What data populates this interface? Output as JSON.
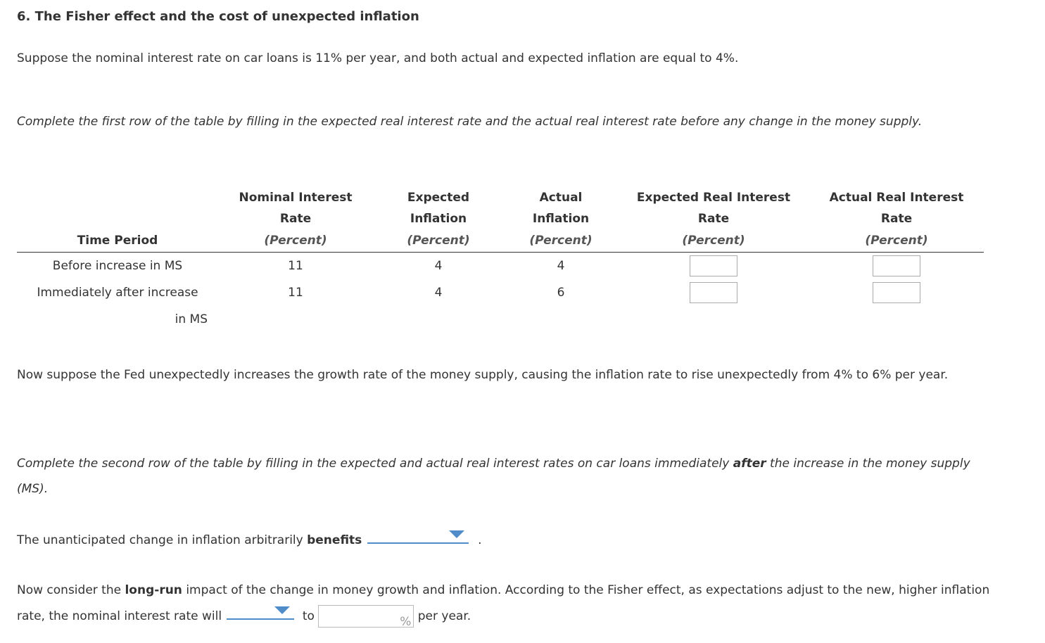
{
  "title": "6. The Fisher effect and the cost of unexpected inflation",
  "intro": "Suppose the nominal interest rate on car loans is 11% per year, and both actual and expected inflation are equal to 4%.",
  "instruction_row1": "Complete the first row of the table by filling in the expected real interest rate and the actual real interest rate before any change in the money supply.",
  "table": {
    "headers": [
      {
        "line1": "",
        "line2": "",
        "line3": "Time Period"
      },
      {
        "line1": "Nominal Interest",
        "line2": "Rate",
        "line3": "(Percent)"
      },
      {
        "line1": "Expected",
        "line2": "Inflation",
        "line3": "(Percent)"
      },
      {
        "line1": "Actual",
        "line2": "Inflation",
        "line3": "(Percent)"
      },
      {
        "line1": "Expected Real Interest",
        "line2": "Rate",
        "line3": "(Percent)"
      },
      {
        "line1": "Actual Real Interest",
        "line2": "Rate",
        "line3": "(Percent)"
      }
    ],
    "rows": [
      {
        "period": "Before increase in MS",
        "nominal": "11",
        "expected_inflation": "4",
        "actual_inflation": "4",
        "expected_real": "",
        "actual_real": ""
      },
      {
        "period_line1": "Immediately after increase",
        "period_line2": "in MS",
        "nominal": "11",
        "expected_inflation": "4",
        "actual_inflation": "6",
        "expected_real": "",
        "actual_real": ""
      }
    ]
  },
  "fed_paragraph": "Now suppose the Fed unexpectedly increases the growth rate of the money supply, causing the inflation rate to rise unexpectedly from 4% to 6% per year.",
  "instruction_row2": {
    "before": "Complete the second row of the table by filling in the expected and actual real interest rates on car loans immediately ",
    "bold": "after",
    "after": " the increase in the money supply (MS)."
  },
  "benefits_sentence": {
    "before": "The unanticipated change in inflation arbitrarily ",
    "bold": "benefits",
    "dropdown_value": "",
    "after": "."
  },
  "longrun": {
    "before": "Now consider the ",
    "bold": "long-run",
    "middle": " impact of the change in money growth and inflation. According to the Fisher effect, as expectations adjust to the new, higher inflation rate, the nominal interest rate will",
    "dropdown_value": "",
    "to": "to",
    "input_value": "",
    "percent_sign": "%",
    "tail": "per year."
  },
  "colors": {
    "accent": "#4f8cc9",
    "text": "#333333"
  }
}
